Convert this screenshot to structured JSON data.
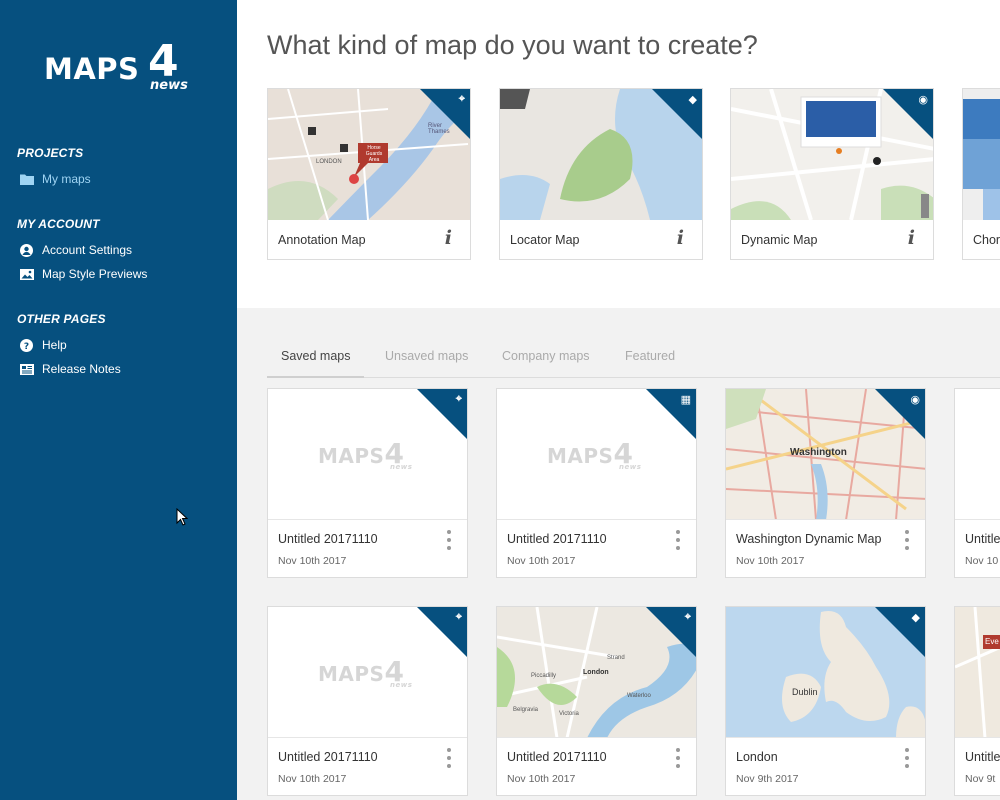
{
  "sidebar": {
    "logo_text": "MAPS",
    "logo_number": "4",
    "logo_sub": "news",
    "sections": {
      "projects": "PROJECTS",
      "my_account": "MY ACCOUNT",
      "other_pages": "OTHER PAGES"
    },
    "items": {
      "my_maps": "My maps",
      "account_settings": "Account Settings",
      "map_style_previews": "Map Style Previews",
      "help": "Help",
      "release_notes": "Release Notes"
    }
  },
  "main": {
    "title": "What kind of map do you want to create?",
    "map_types": [
      {
        "label": "Annotation Map",
        "info": "i",
        "icon": "pin-marker-icon"
      },
      {
        "label": "Locator Map",
        "info": "i",
        "icon": "country-shape-icon"
      },
      {
        "label": "Dynamic Map",
        "info": "i",
        "icon": "globe-icon"
      },
      {
        "label": "Chor",
        "info": "",
        "icon": ""
      }
    ],
    "thumbnail_labels": {
      "london": "LONDON",
      "river_thames": "River Thames",
      "horse_guards": "Horse Guards Area",
      "washington": "Washington",
      "dublin": "Dublin",
      "london_map": "London",
      "strand": "Strand",
      "waterloo": "Waterloo",
      "piccadilly": "Piccadilly",
      "belgravia": "Belgravia",
      "victoria": "Victoria",
      "event": "Eve"
    },
    "tabs": [
      {
        "label": "Saved maps",
        "active": true
      },
      {
        "label": "Unsaved maps",
        "active": false
      },
      {
        "label": "Company maps",
        "active": false
      },
      {
        "label": "Featured",
        "active": false
      }
    ],
    "placeholder": {
      "text": "MAPS",
      "number": "4",
      "sub": "news"
    },
    "saved_maps": [
      {
        "name": "Untitled 20171110",
        "date": "Nov 10th 2017"
      },
      {
        "name": "Untitled 20171110",
        "date": "Nov 10th 2017"
      },
      {
        "name": "Washington Dynamic Map",
        "date": "Nov 10th 2017"
      },
      {
        "name": "Untitle",
        "date": "Nov 10"
      },
      {
        "name": "Untitled 20171110",
        "date": "Nov 10th 2017"
      },
      {
        "name": "Untitled 20171110",
        "date": "Nov 10th 2017"
      },
      {
        "name": "London",
        "date": "Nov 9th 2017"
      },
      {
        "name": "Untitle",
        "date": "Nov 9t"
      }
    ]
  },
  "colors": {
    "sidebar": "#06507f",
    "active_nav": "#9fd4f3",
    "corner_badge": "#06507f"
  }
}
